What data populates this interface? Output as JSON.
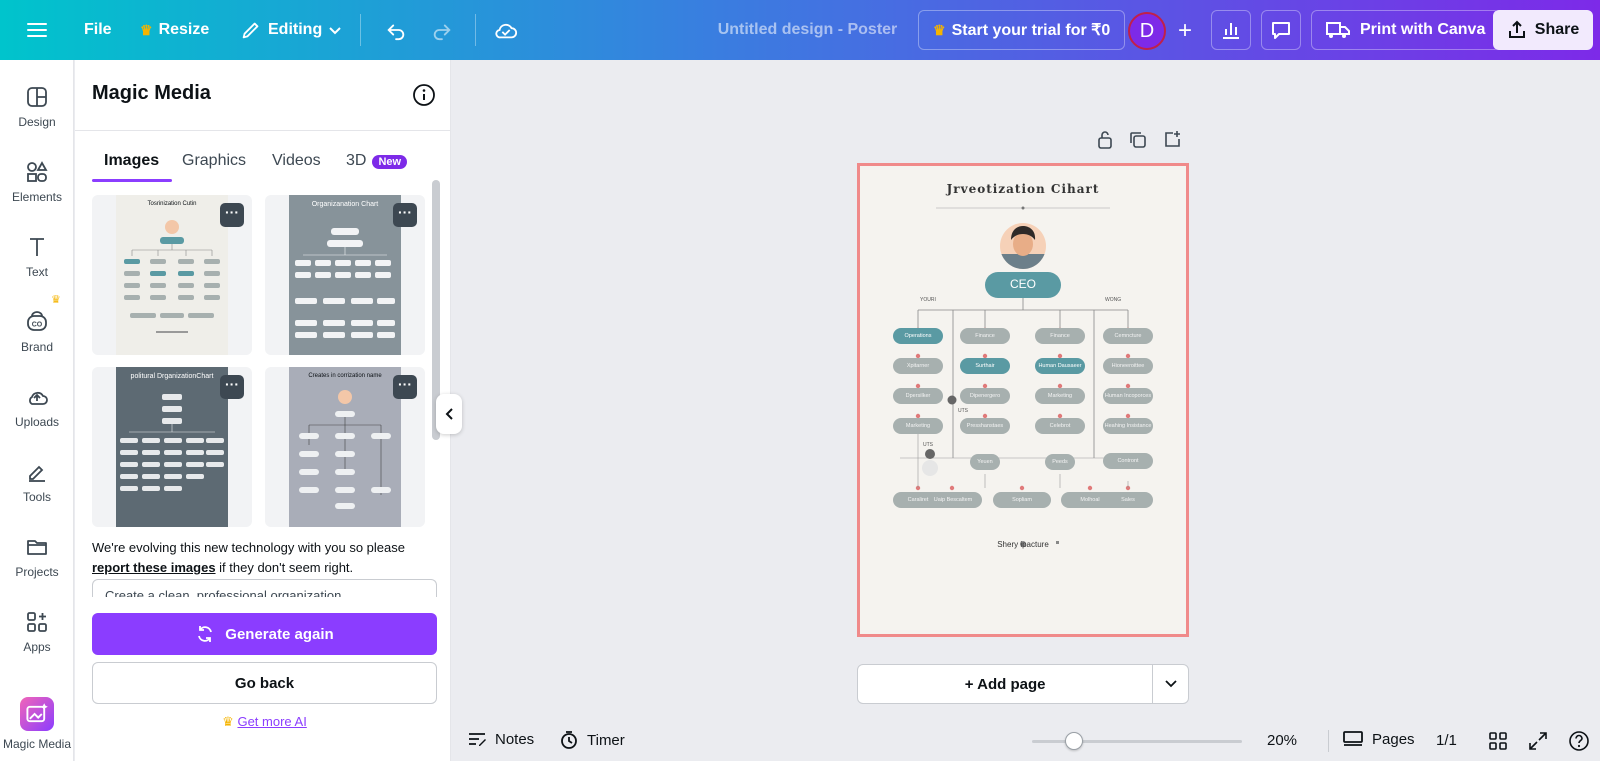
{
  "topbar": {
    "file_label": "File",
    "resize_label": "Resize",
    "editing_label": "Editing",
    "doc_title": "Untitled design - Poster",
    "trial_label": "Start your trial for ₹0",
    "avatar_initial": "D",
    "print_label": "Print with Canva",
    "share_label": "Share",
    "brand_colors": {
      "gradient_start": "#00c4cc",
      "gradient_end": "#7d2ae8",
      "crown": "#f5b400"
    }
  },
  "rail": {
    "items": [
      {
        "label": "Design",
        "icon": "design-icon"
      },
      {
        "label": "Elements",
        "icon": "elements-icon"
      },
      {
        "label": "Text",
        "icon": "text-icon"
      },
      {
        "label": "Brand",
        "icon": "brand-icon"
      },
      {
        "label": "Uploads",
        "icon": "uploads-icon"
      },
      {
        "label": "Tools",
        "icon": "tools-icon"
      },
      {
        "label": "Projects",
        "icon": "projects-icon"
      },
      {
        "label": "Apps",
        "icon": "apps-icon"
      },
      {
        "label": "Magic Media",
        "icon": "magic-media-icon"
      }
    ]
  },
  "panel": {
    "title": "Magic Media",
    "tabs": [
      {
        "label": "Images",
        "active": true
      },
      {
        "label": "Graphics",
        "active": false
      },
      {
        "label": "Videos",
        "active": false
      },
      {
        "label": "3D",
        "active": false,
        "badge": "New"
      }
    ],
    "thumbs": [
      {
        "title": "Tosrinization Cutin"
      },
      {
        "title": "Organizanation Chart"
      },
      {
        "title": "politural DrganizationChart"
      },
      {
        "title": "Creates in corrization name"
      }
    ],
    "notice_before": "We're evolving this new technology with you so please ",
    "notice_link": "report these images",
    "notice_after": " if they don't seem right.",
    "prompt_text": "Create a clean, professional organization",
    "generate_label": "Generate again",
    "back_label": "Go back",
    "getmore_label": "Get more AI",
    "accent": "#8b3dff"
  },
  "poster": {
    "title": "Jrveotization Cihart",
    "ceo": "CEO",
    "group_left": "YOURI",
    "group_right": "WONG",
    "footer": "Shery ipacture",
    "col1": [
      "Operations",
      "Xpitarner",
      "Dpersilker",
      "Marketing"
    ],
    "col2": [
      "Finance",
      "Surthair",
      "Dipenergero",
      "Presshanstaes",
      "Yeuen"
    ],
    "col3": [
      "Finance",
      "Human Dausaeer",
      "Marketing",
      "Celebrot",
      "Peeds"
    ],
    "col4": [
      "Cemncture",
      "Hioneeroittee",
      "Human Incoporces",
      "Heahing Insistance",
      "Contront"
    ],
    "bottom": [
      "Caraliret",
      "Uaip Bescaltem",
      "Sopliam",
      "Molhoal",
      "Sales"
    ],
    "small_labels": [
      "UTS",
      "UTS"
    ],
    "teal": "#5a9aa3",
    "grey": "#a7b0af"
  },
  "canvas": {
    "add_page_label": "+ Add page"
  },
  "bottombar": {
    "notes_label": "Notes",
    "timer_label": "Timer",
    "zoom_label": "20%",
    "zoom_value": 20,
    "pages_label": "Pages",
    "page_count": "1/1"
  }
}
